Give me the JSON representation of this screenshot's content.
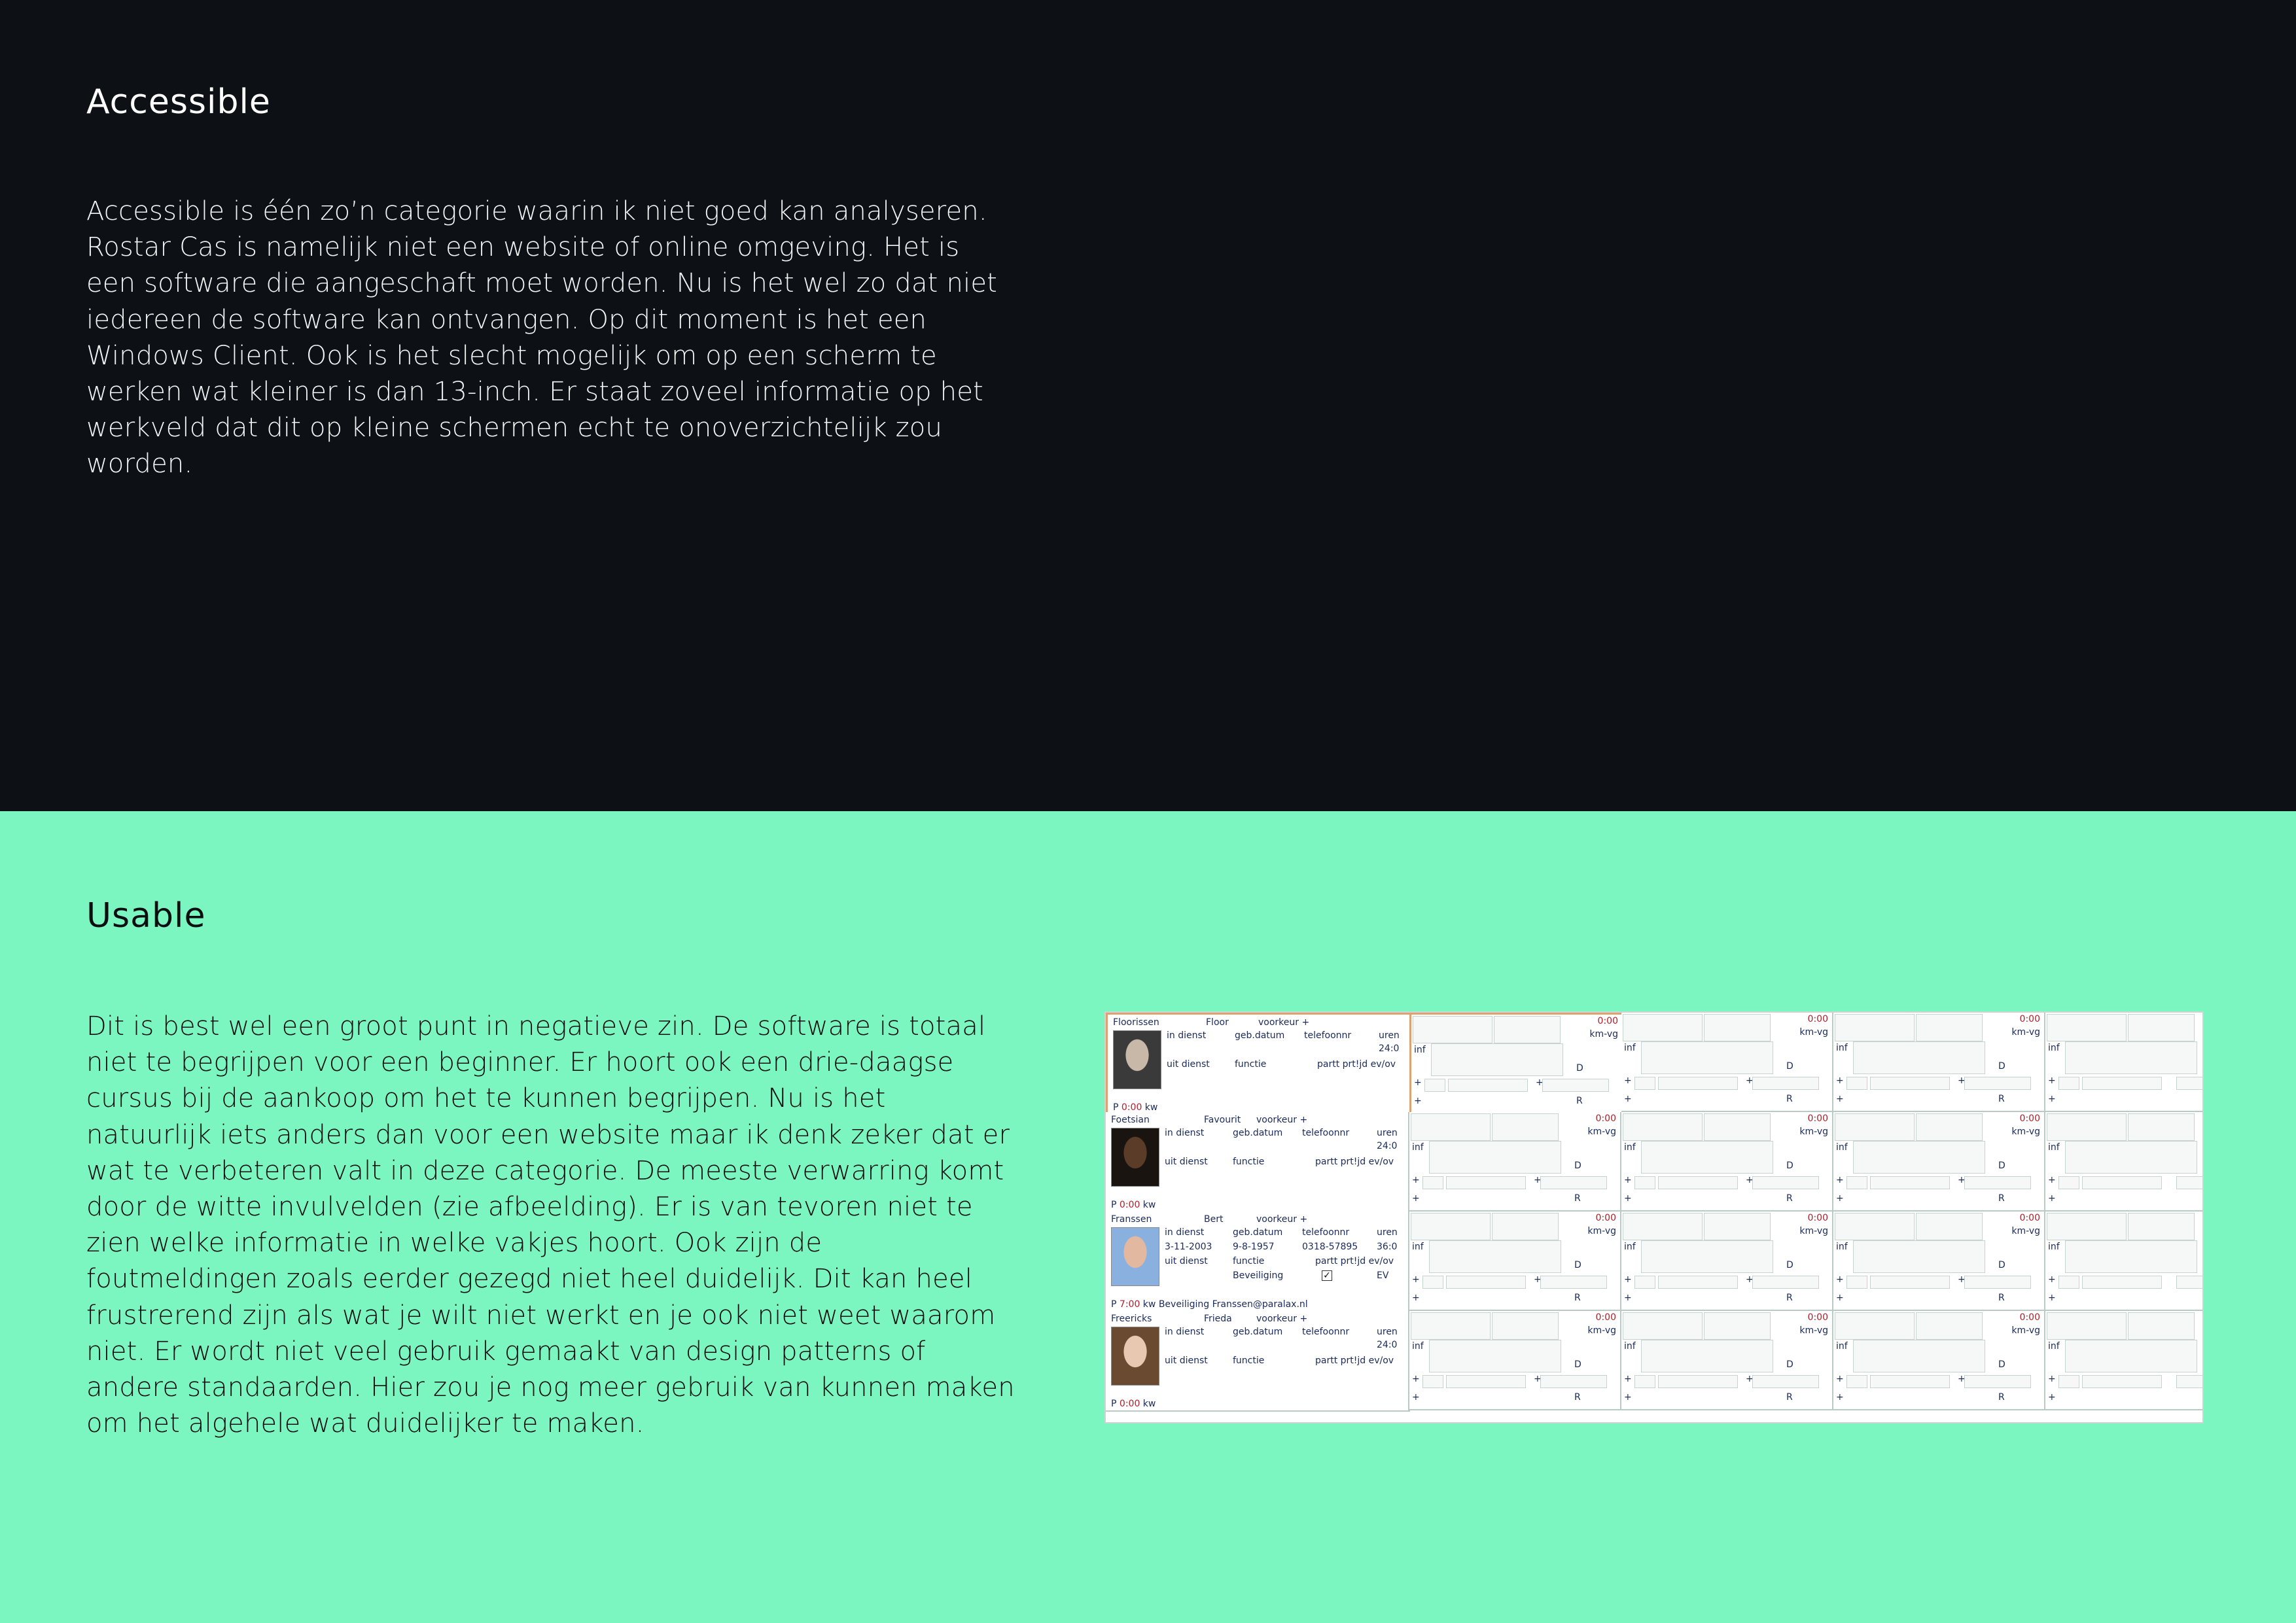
{
  "accessible": {
    "title": "Accessible",
    "body": "Accessible is één zo’n categorie waarin ik niet goed kan analyseren. Rostar Cas is namelijk niet een website of online omgeving. Het is een software die aangeschaft moet worden. Nu is het wel zo dat niet iedereen de software kan ontvangen. Op dit moment is het een Windows Client. Ook is het slecht mogelijk om op een scherm te werken wat kleiner is dan 13-inch. Er staat zoveel informatie op het werkveld dat dit op kleine schermen echt te onoverzichtelijk zou worden."
  },
  "usable": {
    "title": "Usable",
    "body": "Dit is best wel een groot punt in negatieve zin. De software is totaal niet te begrijpen voor een beginner. Er hoort ook een drie-daagse cursus bij de aankoop om het te kunnen begrijpen. Nu is het natuurlijk iets anders dan voor een website maar ik denk zeker dat er wat te verbeteren valt in deze categorie. De meeste verwarring komt door de witte invulvelden (zie afbeelding). Er is van tevoren niet te zien welke informatie in welke vakjes hoort. Ook zijn de foutmeldingen zoals eerder gezegd niet heel duidelijk. Dit kan heel frustrerend zijn als wat je wilt niet werkt en je ook niet weet waarom niet. Er wordt niet veel gebruik gemaakt van design patterns of andere standaarden. Hier zou je nog meer gebruik van kunnen maken om het algehele wat duidelijker te maken."
  },
  "screenshot": {
    "labels": {
      "pref": "voorkeur +",
      "indienst": "in dienst",
      "gebdatum": "geb.datum",
      "telefoon": "telefoonnr",
      "uren": "uren",
      "uitdienst": "uit dienst",
      "functie": "functie",
      "partt": "partt prt!jd ev/ov",
      "kw": "kw",
      "p": "P",
      "time0": "0:00",
      "kmvg": "km-vg",
      "inf": "inf",
      "d": "D",
      "r": "R",
      "plus": "+"
    },
    "employees": [
      {
        "last": "Floorissen",
        "first": "Floor",
        "hours": "0:00",
        "uren_val": "24:0",
        "extra": ""
      },
      {
        "last": "Foetsian",
        "first": "Favourit",
        "hours": "0:00",
        "uren_val": "24:0",
        "extra": ""
      },
      {
        "last": "Franssen",
        "first": "Bert",
        "hours": "7:00",
        "uren_val": "36:0",
        "startdate": "3-11-2003",
        "birthdate": "9-8-1957",
        "phone": "0318-57895",
        "function": "Beveiliging",
        "ev": "EV",
        "dept": "Beveiliging",
        "email": "Franssen@paralax.nl"
      },
      {
        "last": "Freericks",
        "first": "Frieda",
        "hours": "0:00",
        "uren_val": "24:0",
        "extra": ""
      }
    ]
  }
}
